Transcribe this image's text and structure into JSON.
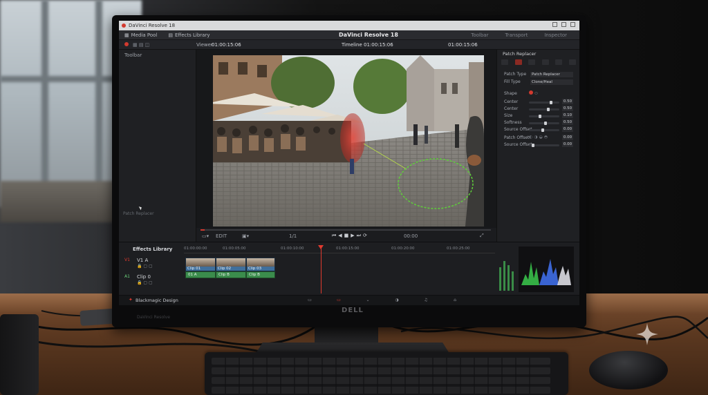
{
  "window": {
    "title": "DaVinci Resolve 18",
    "app_title": "DaVinci Resolve 18"
  },
  "menubar": {
    "media_pool": "Media Pool",
    "effects_library": "Effects Library",
    "right_tabs": [
      "Toolbar",
      "Transport",
      "Inspector"
    ]
  },
  "toolrow": {
    "toolbar_label": "Toolbar",
    "viewer_label": "Viewer",
    "timecode_left": "01:00:15:06",
    "timecode_center": "Timeline 01:00:15:06",
    "timecode_right": "01:00:15:06"
  },
  "sidebar": {
    "hint": "Patch Replacer"
  },
  "viewer_ctrl": {
    "zoom": "EDIT",
    "page": "1/1",
    "speed": "00:00"
  },
  "inspector": {
    "header": "Patch Replacer",
    "fields": [
      {
        "label": "Patch Type",
        "value": "Patch Replacer"
      },
      {
        "label": "Fill Type",
        "value": "Clone/Heal"
      }
    ],
    "sliders": [
      {
        "label": "Shape",
        "value": ""
      },
      {
        "label": "Center",
        "value": "0.50"
      },
      {
        "label": "Center",
        "value": "0.50"
      },
      {
        "label": "Size",
        "value": "0.10"
      },
      {
        "label": "Softness",
        "value": "0.50"
      },
      {
        "label": "Source Offset",
        "value": "0.00"
      },
      {
        "label": "Patch Offset",
        "value": "0.00"
      },
      {
        "label": "Source Offset",
        "value": "0.00"
      }
    ]
  },
  "timeline": {
    "effects_library": "Effects Library",
    "tracks": [
      {
        "tag": "V1",
        "name": "V1 A"
      },
      {
        "tag": "A1",
        "name": "Clip 0"
      }
    ],
    "ruler_ticks": [
      "01:00:00:00",
      "01:00:05:00",
      "01:00:10:00",
      "01:00:15:00",
      "01:00:20:00",
      "01:00:25:00"
    ],
    "clips": [
      {
        "label": "Clip 01",
        "audio": "01 A"
      },
      {
        "label": "Clip 02",
        "audio": "Clip B"
      },
      {
        "label": "Clip 03",
        "audio": "Clip B"
      }
    ],
    "playhead_progress": 0.55,
    "meter_levels": [
      0.55,
      0.7,
      0.6,
      0.45
    ]
  },
  "page_bar": {
    "brand": "Blackmagic Design",
    "pages": [
      "Media",
      "Cut",
      "Edit",
      "Fusion",
      "Color",
      "Fairlight",
      "Deliver"
    ],
    "active_page": "Edit"
  },
  "bezel": {
    "label": "DaVinci Resolve"
  },
  "colors": {
    "accent": "#e23a2f",
    "video_clip": "#3f6f9c",
    "audio_clip": "#3b8c4c",
    "mask_outline": "#5fd03a"
  }
}
